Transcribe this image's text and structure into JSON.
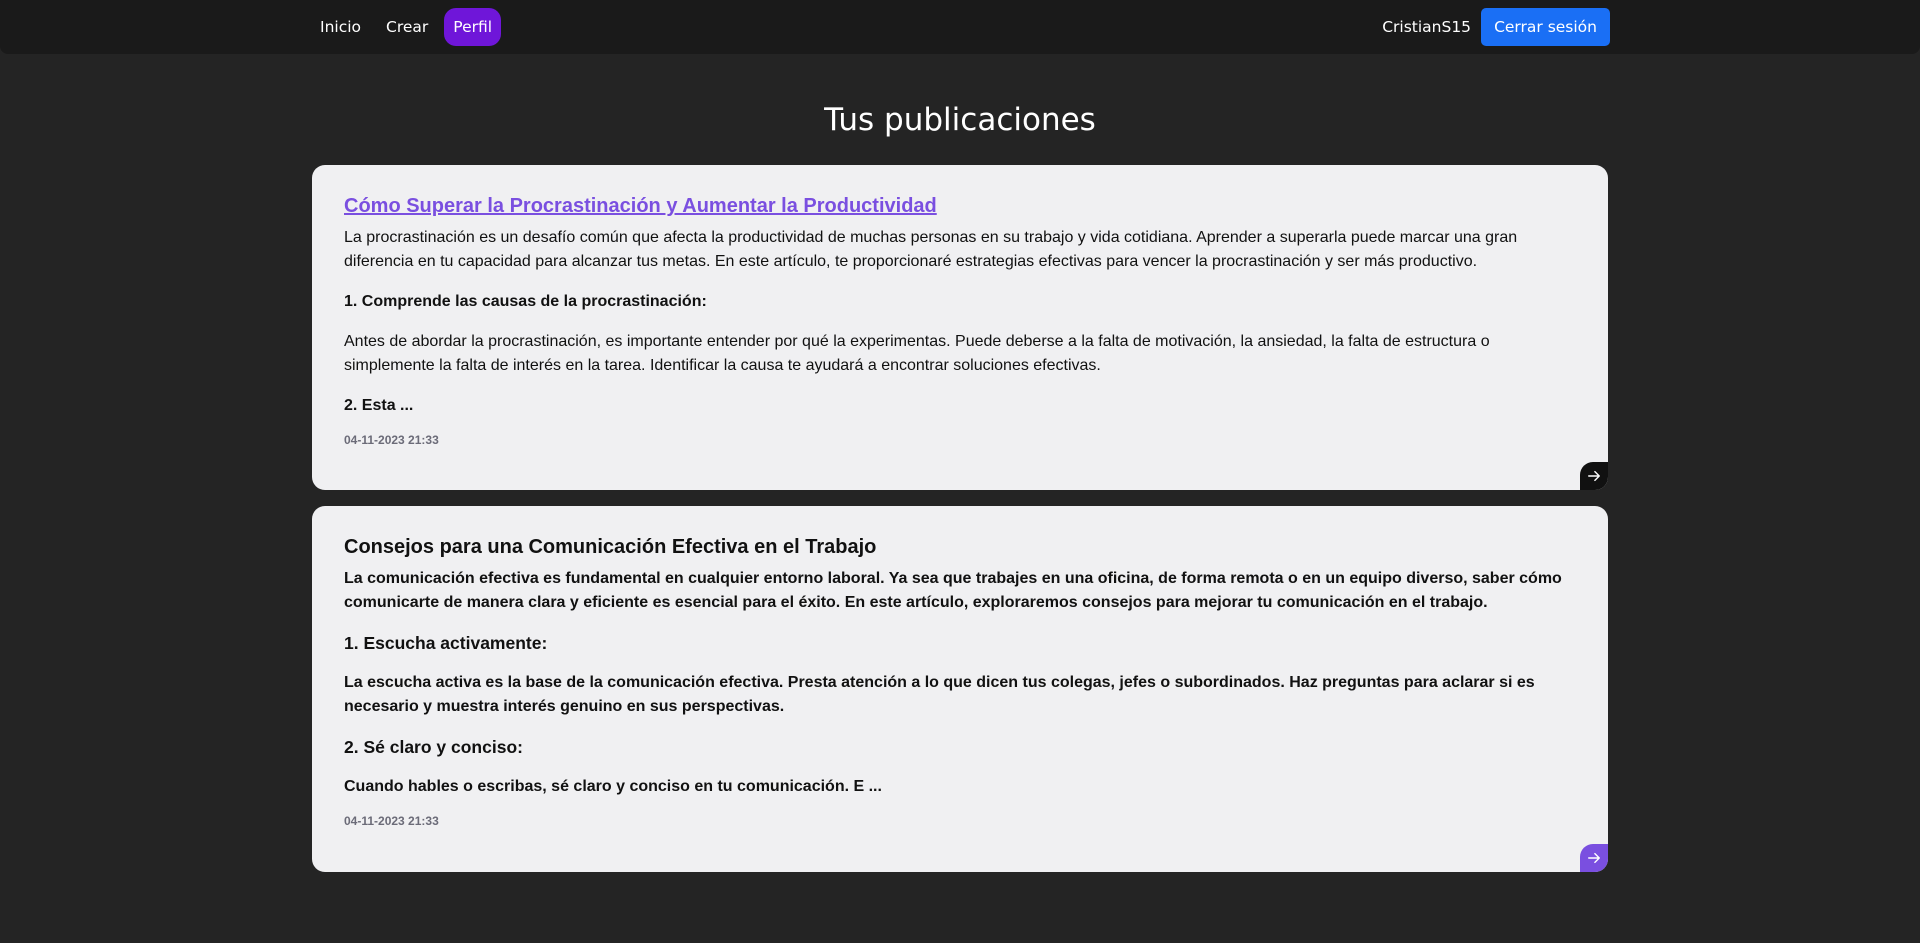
{
  "nav": {
    "links": [
      "Inicio",
      "Crear",
      "Perfil"
    ],
    "username": "CristianS15",
    "logout_label": "Cerrar sesión"
  },
  "page_title": "Tus publicaciones",
  "posts": [
    {
      "title": "Cómo Superar la Procrastinación y Aumentar la Productividad",
      "paragraphs": [
        "La procrastinación es un desafío común que afecta la productividad de muchas personas en su trabajo y vida cotidiana. Aprender a superarla puede marcar una gran diferencia en tu capacidad para alcanzar tus metas. En este artículo, te proporcionaré estrategias efectivas para vencer la procrastinación y ser más productivo.",
        "1. Comprende las causas de la procrastinación:",
        "Antes de abordar la procrastinación, es importante entender por qué la experimentas. Puede deberse a la falta de motivación, la ansiedad, la falta de estructura o simplemente la falta de interés en la tarea. Identificar la causa te ayudará a encontrar soluciones efectivas.",
        "2. Esta ..."
      ],
      "date": "04-11-2023 21:33"
    },
    {
      "title": "Consejos para una Comunicación Efectiva en el Trabajo",
      "paragraphs": [
        "La comunicación efectiva es fundamental en cualquier entorno laboral. Ya sea que trabajes en una oficina, de forma remota o en un equipo diverso, saber cómo comunicarte de manera clara y eficiente es esencial para el éxito. En este artículo, exploraremos consejos para mejorar tu comunicación en el trabajo.",
        "1. Escucha activamente:",
        "La escucha activa es la base de la comunicación efectiva. Presta atención a lo que dicen tus colegas, jefes o subordinados. Haz preguntas para aclarar si es necesario y muestra interés genuino en sus perspectivas.",
        "2. Sé claro y conciso:",
        "Cuando hables o escribas, sé claro y conciso en tu comunicación. E ..."
      ],
      "date": "04-11-2023 21:33"
    }
  ],
  "colors": {
    "background": "#242424",
    "navbar": "#1a1a1a",
    "active_nav": "#6f16d9",
    "logout_button": "#1a6ff5",
    "link_title": "#7a4fe0",
    "card": "#f0f0f2"
  }
}
